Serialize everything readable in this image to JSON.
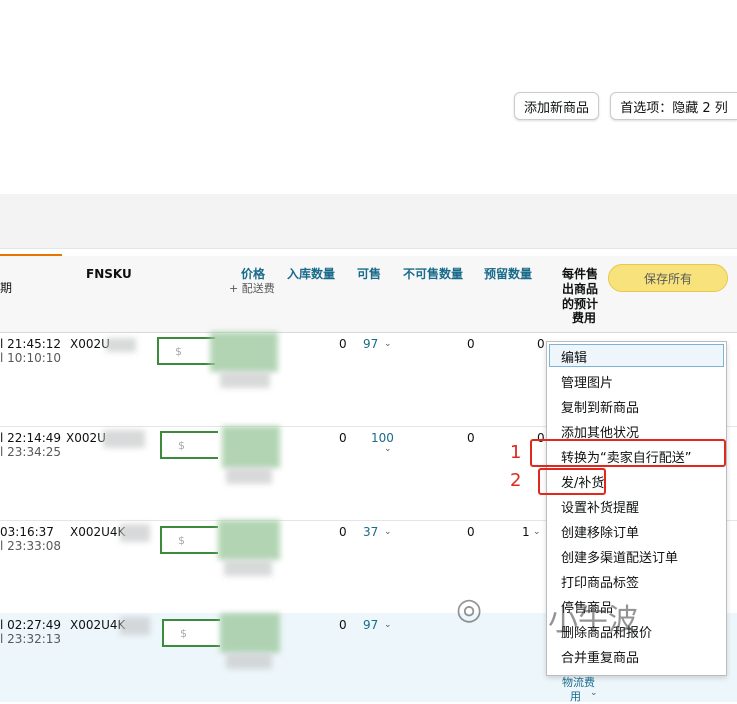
{
  "toolbar": {
    "add_product": "添加新商品",
    "preferences": "首选项：隐藏 2 列"
  },
  "header": {
    "col_date_fragment": "期",
    "fnsku": "FNSKU",
    "price": "价格",
    "price_sub": "+ 配送费",
    "inbound": "入库数量",
    "available": "可售",
    "unsellable": "不可售数量",
    "reserved": "预留数量",
    "fee_line1": "每件售",
    "fee_line2": "出商品",
    "fee_line3": "的预计",
    "fee_line4": "费用",
    "save_all": "保存所有"
  },
  "rows": [
    {
      "date1": "l 21:45:12",
      "date2": "l 10:10:10",
      "fnsku": "X002U",
      "price_placeholder": "$",
      "inbound": "0",
      "available": "97",
      "unsellable": "0",
      "reserved": "0"
    },
    {
      "date1": "l 22:14:49",
      "date2": "l 23:34:25",
      "fnsku": "X002U",
      "price_placeholder": "$",
      "inbound": "0",
      "available": "100",
      "unsellable": "0",
      "reserved": "0"
    },
    {
      "date1": "03:16:37",
      "date2": "l 23:33:08",
      "fnsku": "X002U4K",
      "price_placeholder": "$",
      "inbound": "0",
      "available": "37",
      "unsellable": "0",
      "reserved": "1"
    },
    {
      "date1": "l 02:27:49",
      "date2": "l 23:32:13",
      "fnsku": "X002U4K",
      "price_placeholder": "$",
      "inbound": "0",
      "available": "97",
      "unsellable": "",
      "reserved": ""
    }
  ],
  "menu": {
    "items": [
      "编辑",
      "管理图片",
      "复制到新商品",
      "添加其他状况",
      "转换为“卖家自行配送”",
      "发/补货",
      "设置补货提醒",
      "创建移除订单",
      "创建多渠道配送订单",
      "打印商品标签",
      "停售商品",
      "删除商品和报价",
      "合并重复商品"
    ]
  },
  "annotations": {
    "mark1": "1",
    "mark2": "2"
  },
  "footer_fee": {
    "line1": "物流费",
    "line2": "用"
  },
  "watermark": {
    "text": "小牛波"
  },
  "colors": {
    "save_button": "#f8e27c",
    "annotation_red": "#e0281e",
    "link_teal": "#1a6a8a",
    "price_box_green": "#3c8b3c"
  }
}
